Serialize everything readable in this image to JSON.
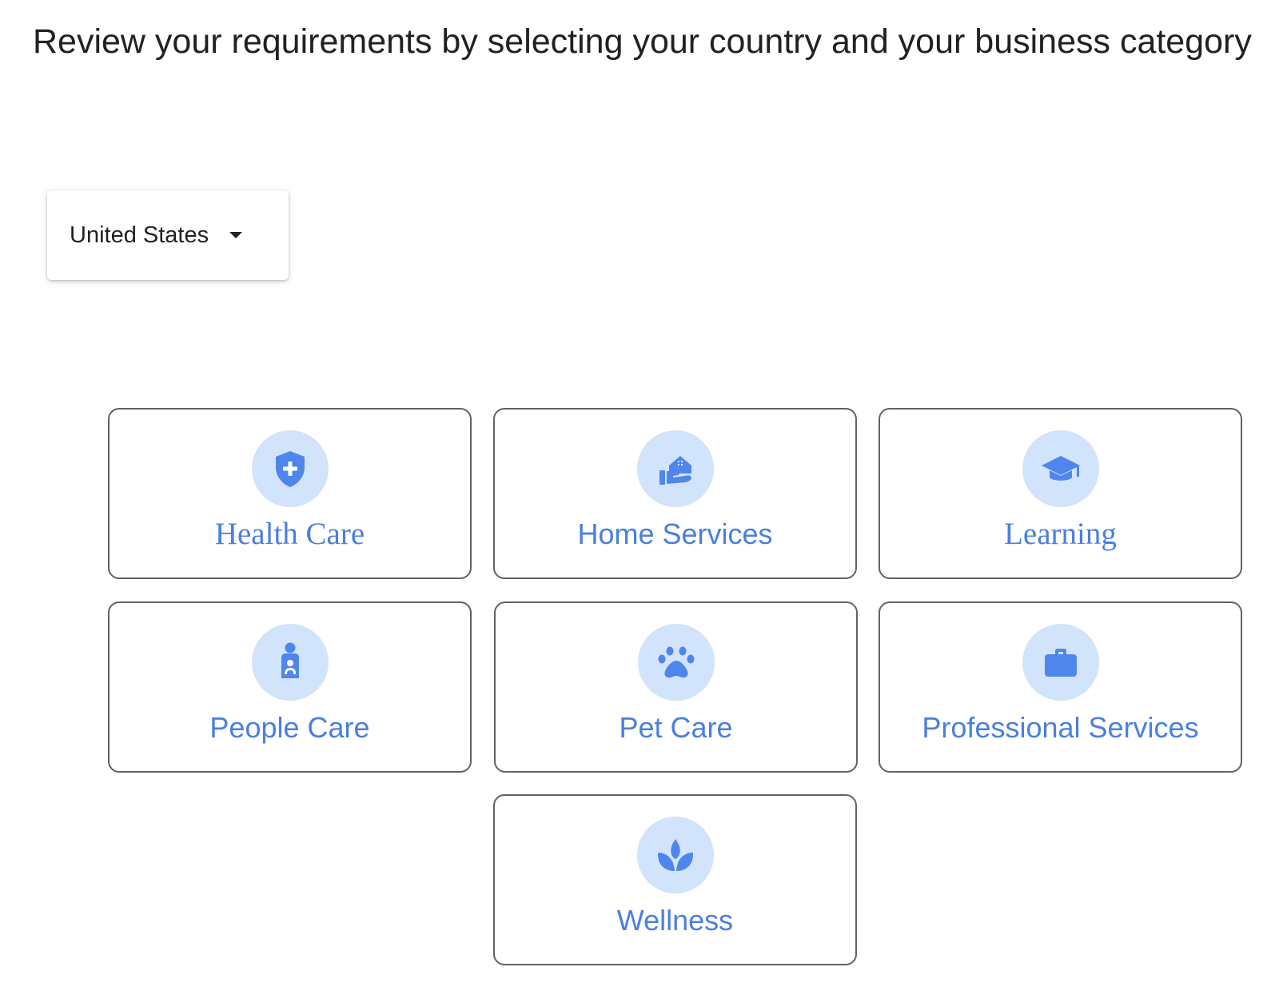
{
  "page": {
    "title": "Review your requirements by selecting your country and your business category"
  },
  "country_select": {
    "selected": "United States",
    "icon": "caret-down-icon"
  },
  "categories": [
    {
      "label": "Health Care",
      "icon": "shield-plus-icon"
    },
    {
      "label": "Home Services",
      "icon": "home-hand-icon"
    },
    {
      "label": "Learning",
      "icon": "graduation-cap-icon"
    },
    {
      "label": "People Care",
      "icon": "person-care-icon"
    },
    {
      "label": "Pet Care",
      "icon": "paw-icon"
    },
    {
      "label": "Professional Services",
      "icon": "briefcase-icon"
    },
    {
      "label": "Wellness",
      "icon": "lotus-icon"
    }
  ],
  "colors": {
    "accent": "#4a7fe0",
    "icon_fill": "#4f86ec",
    "icon_background": "#d2e3fc",
    "card_border": "#5f6368",
    "text": "#202124"
  }
}
